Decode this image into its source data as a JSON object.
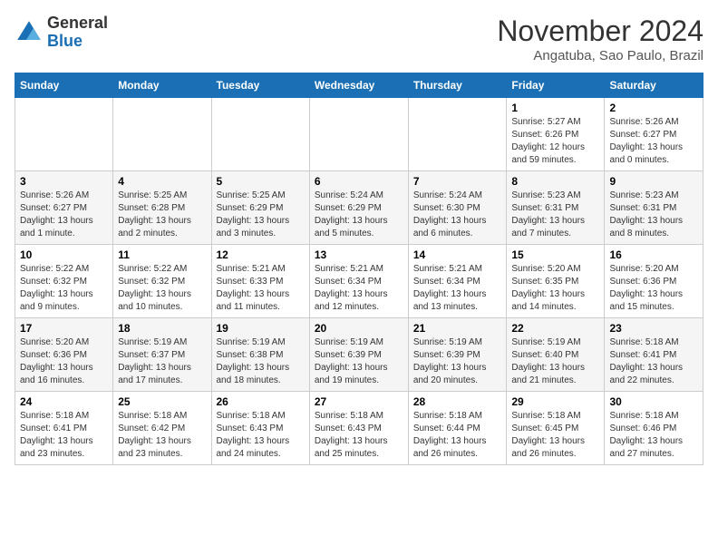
{
  "header": {
    "logo_line1": "General",
    "logo_line2": "Blue",
    "month": "November 2024",
    "location": "Angatuba, Sao Paulo, Brazil"
  },
  "weekdays": [
    "Sunday",
    "Monday",
    "Tuesday",
    "Wednesday",
    "Thursday",
    "Friday",
    "Saturday"
  ],
  "weeks": [
    [
      {
        "day": "",
        "info": ""
      },
      {
        "day": "",
        "info": ""
      },
      {
        "day": "",
        "info": ""
      },
      {
        "day": "",
        "info": ""
      },
      {
        "day": "",
        "info": ""
      },
      {
        "day": "1",
        "info": "Sunrise: 5:27 AM\nSunset: 6:26 PM\nDaylight: 12 hours and 59 minutes."
      },
      {
        "day": "2",
        "info": "Sunrise: 5:26 AM\nSunset: 6:27 PM\nDaylight: 13 hours and 0 minutes."
      }
    ],
    [
      {
        "day": "3",
        "info": "Sunrise: 5:26 AM\nSunset: 6:27 PM\nDaylight: 13 hours and 1 minute."
      },
      {
        "day": "4",
        "info": "Sunrise: 5:25 AM\nSunset: 6:28 PM\nDaylight: 13 hours and 2 minutes."
      },
      {
        "day": "5",
        "info": "Sunrise: 5:25 AM\nSunset: 6:29 PM\nDaylight: 13 hours and 3 minutes."
      },
      {
        "day": "6",
        "info": "Sunrise: 5:24 AM\nSunset: 6:29 PM\nDaylight: 13 hours and 5 minutes."
      },
      {
        "day": "7",
        "info": "Sunrise: 5:24 AM\nSunset: 6:30 PM\nDaylight: 13 hours and 6 minutes."
      },
      {
        "day": "8",
        "info": "Sunrise: 5:23 AM\nSunset: 6:31 PM\nDaylight: 13 hours and 7 minutes."
      },
      {
        "day": "9",
        "info": "Sunrise: 5:23 AM\nSunset: 6:31 PM\nDaylight: 13 hours and 8 minutes."
      }
    ],
    [
      {
        "day": "10",
        "info": "Sunrise: 5:22 AM\nSunset: 6:32 PM\nDaylight: 13 hours and 9 minutes."
      },
      {
        "day": "11",
        "info": "Sunrise: 5:22 AM\nSunset: 6:32 PM\nDaylight: 13 hours and 10 minutes."
      },
      {
        "day": "12",
        "info": "Sunrise: 5:21 AM\nSunset: 6:33 PM\nDaylight: 13 hours and 11 minutes."
      },
      {
        "day": "13",
        "info": "Sunrise: 5:21 AM\nSunset: 6:34 PM\nDaylight: 13 hours and 12 minutes."
      },
      {
        "day": "14",
        "info": "Sunrise: 5:21 AM\nSunset: 6:34 PM\nDaylight: 13 hours and 13 minutes."
      },
      {
        "day": "15",
        "info": "Sunrise: 5:20 AM\nSunset: 6:35 PM\nDaylight: 13 hours and 14 minutes."
      },
      {
        "day": "16",
        "info": "Sunrise: 5:20 AM\nSunset: 6:36 PM\nDaylight: 13 hours and 15 minutes."
      }
    ],
    [
      {
        "day": "17",
        "info": "Sunrise: 5:20 AM\nSunset: 6:36 PM\nDaylight: 13 hours and 16 minutes."
      },
      {
        "day": "18",
        "info": "Sunrise: 5:19 AM\nSunset: 6:37 PM\nDaylight: 13 hours and 17 minutes."
      },
      {
        "day": "19",
        "info": "Sunrise: 5:19 AM\nSunset: 6:38 PM\nDaylight: 13 hours and 18 minutes."
      },
      {
        "day": "20",
        "info": "Sunrise: 5:19 AM\nSunset: 6:39 PM\nDaylight: 13 hours and 19 minutes."
      },
      {
        "day": "21",
        "info": "Sunrise: 5:19 AM\nSunset: 6:39 PM\nDaylight: 13 hours and 20 minutes."
      },
      {
        "day": "22",
        "info": "Sunrise: 5:19 AM\nSunset: 6:40 PM\nDaylight: 13 hours and 21 minutes."
      },
      {
        "day": "23",
        "info": "Sunrise: 5:18 AM\nSunset: 6:41 PM\nDaylight: 13 hours and 22 minutes."
      }
    ],
    [
      {
        "day": "24",
        "info": "Sunrise: 5:18 AM\nSunset: 6:41 PM\nDaylight: 13 hours and 23 minutes."
      },
      {
        "day": "25",
        "info": "Sunrise: 5:18 AM\nSunset: 6:42 PM\nDaylight: 13 hours and 23 minutes."
      },
      {
        "day": "26",
        "info": "Sunrise: 5:18 AM\nSunset: 6:43 PM\nDaylight: 13 hours and 24 minutes."
      },
      {
        "day": "27",
        "info": "Sunrise: 5:18 AM\nSunset: 6:43 PM\nDaylight: 13 hours and 25 minutes."
      },
      {
        "day": "28",
        "info": "Sunrise: 5:18 AM\nSunset: 6:44 PM\nDaylight: 13 hours and 26 minutes."
      },
      {
        "day": "29",
        "info": "Sunrise: 5:18 AM\nSunset: 6:45 PM\nDaylight: 13 hours and 26 minutes."
      },
      {
        "day": "30",
        "info": "Sunrise: 5:18 AM\nSunset: 6:46 PM\nDaylight: 13 hours and 27 minutes."
      }
    ]
  ]
}
